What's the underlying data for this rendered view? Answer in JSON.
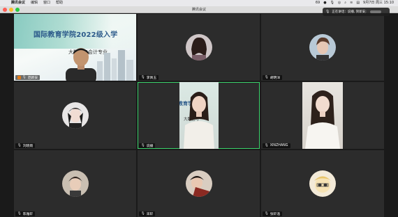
{
  "menubar": {
    "apple_icon": "apple-icon",
    "items": [
      "腾讯会议",
      "编辑",
      "窗口",
      "帮助"
    ],
    "battery": "69",
    "datetime": "9月7日 周三  15:10"
  },
  "window": {
    "title": "腾讯会议"
  },
  "speaking_toast": {
    "label": "正在讲话：说播, 贺新安;"
  },
  "presentation": {
    "title": "国际教育学院2022级入学",
    "subtitle": "大数据与会计专业"
  },
  "camera_bg": {
    "text1": "教育学院",
    "text2": "大数据与"
  },
  "participants": [
    {
      "name": "范新安",
      "host": true,
      "mic": "muted"
    },
    {
      "name": "李佩玉",
      "mic": "muted"
    },
    {
      "name": "胡明洋",
      "mic": "muted"
    },
    {
      "name": "刘晓雨",
      "mic": "muted"
    },
    {
      "name": "说播",
      "mic": "on"
    },
    {
      "name": "XINZHANG",
      "mic": "muted"
    },
    {
      "name": "陈雅轩",
      "mic": "muted"
    },
    {
      "name": "宋轩",
      "mic": "muted"
    },
    {
      "name": "张轩浩",
      "mic": "muted"
    }
  ],
  "colors": {
    "active_speaker_border": "#3ad26a",
    "tile_background": "#2c2c2c",
    "title_color": "#2c5a8a"
  }
}
